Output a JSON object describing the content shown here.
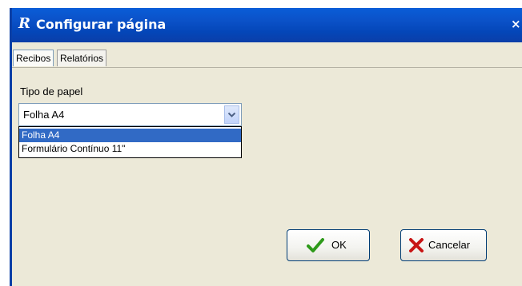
{
  "window": {
    "app_icon": "R-logo-icon",
    "title": "Configurar página",
    "close_glyph": "×"
  },
  "tabs": [
    {
      "label": "Recibos",
      "active": true
    },
    {
      "label": "Relatórios",
      "active": false
    }
  ],
  "paper_type": {
    "label": "Tipo de papel",
    "selected": "Folha A4",
    "options": [
      {
        "label": "Folha A4",
        "highlighted": true
      },
      {
        "label": "Formulário Contínuo 11\"",
        "highlighted": false
      }
    ]
  },
  "buttons": {
    "ok_label": "OK",
    "cancel_label": "Cancelar"
  },
  "colors": {
    "titlebar": "#0a5dd8",
    "selection": "#316ac5",
    "dialog_bg": "#ece9d8",
    "ok_icon": "#2e9a1a",
    "cancel_icon": "#c81414"
  }
}
